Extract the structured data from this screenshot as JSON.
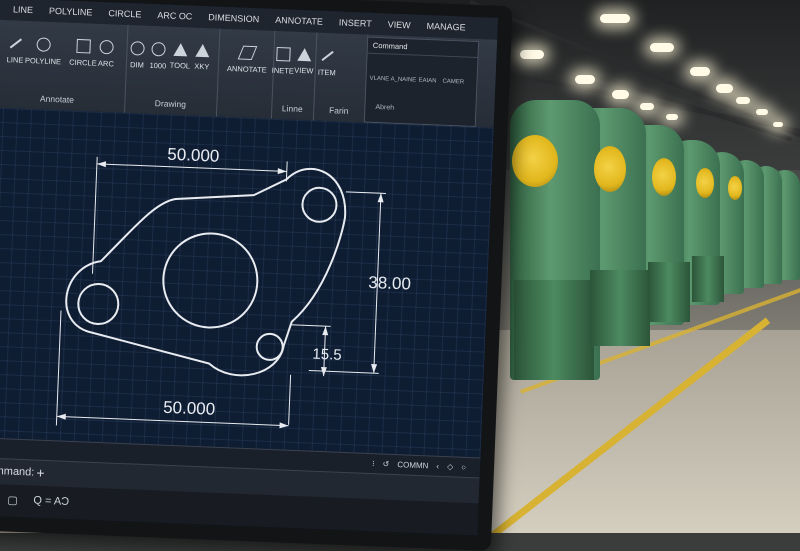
{
  "menu": [
    "LINE",
    "POLYLINE",
    "CIRCLE",
    "ARC OC",
    "DIMENSION",
    "ANNOTATE",
    "INSERT",
    "VIEW",
    "MANAGE"
  ],
  "ribbon": {
    "draw_tools": [
      "LINE",
      "POLYLINE",
      "CIRCLE",
      "ARC"
    ],
    "annotate_group": "Annotate",
    "dim_tools": [
      "DIM",
      "1000",
      "TOOL",
      "XKY"
    ],
    "drawing_group": "Drawing",
    "annotate_label": "ANNOTATE",
    "layer_tools": [
      "INETE",
      "VIEW"
    ],
    "layer_group": "Linne",
    "item_label": "ITEM",
    "form_group": "Farin",
    "command_title": "Command",
    "command_tools": [
      "VLANE",
      "A_NAINE",
      "EAIAN",
      "CAMER"
    ],
    "command_group": "Abreh"
  },
  "drawing": {
    "top_dimension": "50.000",
    "bottom_dimension": "50.000",
    "right_dimension": "38.00",
    "small_dimension": "15.5"
  },
  "status_text": "COMMN",
  "command_line": {
    "label": "ommand:",
    "plus": "+"
  },
  "taskbar": [
    "Q = AƆ"
  ],
  "colors": {
    "canvas": "#0f1d33",
    "grid": "#2e4466",
    "geometry": "#e8ecf1",
    "ribbon": "#2b323d",
    "press_green": "#4d8a60",
    "press_yellow": "#e9c12b",
    "floor_stripe": "#d8b232"
  }
}
